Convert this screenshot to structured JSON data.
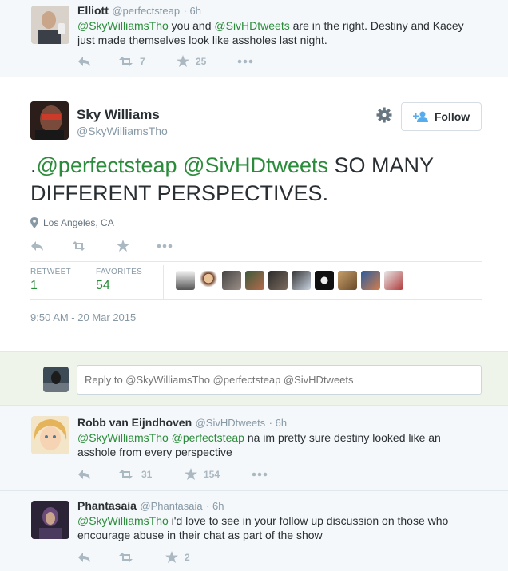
{
  "tweets": {
    "elliott": {
      "name": "Elliott",
      "handle": "@perfectsteap",
      "time": "6h",
      "text_parts": [
        "@SkyWilliamsTho",
        " you and ",
        "@SivHDtweets",
        " are in the right. Destiny and Kacey just made themselves look like assholes last night."
      ],
      "retweets": "7",
      "favorites": "25"
    },
    "robb": {
      "name": "Robb van Eijndhoven",
      "handle": "@SivHDtweets",
      "time": "6h",
      "text_parts": [
        "@SkyWilliamsTho",
        " ",
        "@perfectsteap",
        " na im pretty sure destiny looked like an asshole from every perspective"
      ],
      "retweets": "31",
      "favorites": "154"
    },
    "phantasaia": {
      "name": "Phantasaia",
      "handle": "@Phantasaia",
      "time": "6h",
      "text_parts": [
        "@SkyWilliamsTho",
        " i'd love to see in your follow up discussion on those who encourage abuse in their chat as part of the show"
      ],
      "retweets": "",
      "favorites": "2"
    }
  },
  "main_tweet": {
    "name": "Sky Williams",
    "handle": "@SkyWilliamsTho",
    "follow_label": "Follow",
    "text_parts": [
      ".",
      "@perfectsteap",
      " ",
      "@SivHDtweets",
      " SO MANY DIFFERENT PERSPECTIVES."
    ],
    "location": "Los Angeles, CA",
    "stats": {
      "retweet_label": "RETWEET",
      "retweet_count": "1",
      "favorites_label": "FAVORITES",
      "favorites_count": "54"
    },
    "timestamp": "9:50 AM - 20 Mar 2015"
  },
  "reply_box": {
    "placeholder": "Reply to @SkyWilliamsTho @perfectsteap @SivHDtweets"
  },
  "colors": {
    "mention": "#2a8c3a",
    "action_gray": "#aab8c2",
    "reply_bg": "#eef4ea"
  }
}
